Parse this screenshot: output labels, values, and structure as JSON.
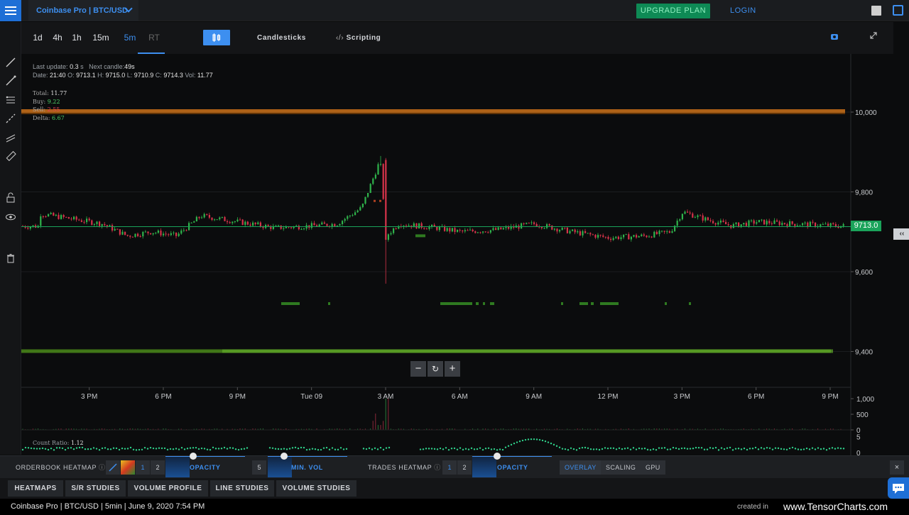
{
  "topbar": {
    "market": "Coinbase Pro | BTC/USD",
    "upgrade": "UPGRADE PLAN",
    "login": "LOGIN"
  },
  "timeframes": [
    "1d",
    "4h",
    "1h",
    "15m",
    "5m",
    "RT"
  ],
  "timeframe_active": "5m",
  "toolbar": {
    "candlesticks": "Candlesticks",
    "scripting": "Scripting"
  },
  "info": {
    "last_update_label": "Last update:",
    "last_update_value": "0.3",
    "last_update_unit": "s",
    "next_candle_label": "Next candle:",
    "next_candle_value": "49s",
    "date_label": "Date:",
    "date": "21:40",
    "o_label": "O:",
    "o": "9713.1",
    "h_label": "H:",
    "h": "9715.0",
    "l_label": "L:",
    "l": "9710.9",
    "c_label": "C:",
    "c": "9714.3",
    "vol_label": "Vol:",
    "vol": "11.77"
  },
  "volume_info": {
    "total_label": "Total:",
    "total": "11.77",
    "buy_label": "Buy:",
    "buy": "9.22",
    "sell_label": "Sell:",
    "sell": "2.55",
    "delta_label": "Delta:",
    "delta": "6.67"
  },
  "current_price": "9713.0",
  "ratio": {
    "label": "Count Ratio:",
    "value": "1.12"
  },
  "colors": {
    "up": "#2fb34b",
    "down": "#d6334a",
    "accent": "#3d8ff0",
    "price_line": "#1aa35a"
  },
  "chart_data": {
    "type": "candlestick",
    "y_axis_ticks": [
      "10,000",
      "9,800",
      "9,600",
      "9,400"
    ],
    "y_range": [
      9350,
      10100
    ],
    "x_ticks": [
      "3 PM",
      "6 PM",
      "9 PM",
      "Tue 09",
      "3 AM",
      "6 AM",
      "9 AM",
      "12 PM",
      "3 PM",
      "6 PM",
      "9 PM"
    ],
    "volume_axis_ticks": [
      "1,000",
      "500",
      "0"
    ],
    "ratio_axis_ticks": [
      "5",
      "0"
    ],
    "orderbook_walls": [
      {
        "price": 10000,
        "side": "ask"
      },
      {
        "price": 9400,
        "side": "bid"
      }
    ],
    "price_path": [
      {
        "t": "13:00",
        "price": 9745
      },
      {
        "t": "14:30",
        "price": 9730
      },
      {
        "t": "15:30",
        "price": 9720
      },
      {
        "t": "16:30",
        "price": 9690
      },
      {
        "t": "17:30",
        "price": 9700
      },
      {
        "t": "18:30",
        "price": 9690
      },
      {
        "t": "19:30",
        "price": 9740
      },
      {
        "t": "21:00",
        "price": 9725
      },
      {
        "t": "22:30",
        "price": 9710
      },
      {
        "t": "00:00",
        "price": 9715
      },
      {
        "t": "01:00",
        "price": 9720
      },
      {
        "t": "02:00",
        "price": 9760
      },
      {
        "t": "02:45",
        "price": 9880
      },
      {
        "t": "03:00",
        "price": 9690
      },
      {
        "t": "03:30",
        "price": 9720
      },
      {
        "t": "05:00",
        "price": 9710
      },
      {
        "t": "06:00",
        "price": 9700
      },
      {
        "t": "07:30",
        "price": 9705
      },
      {
        "t": "09:00",
        "price": 9720
      },
      {
        "t": "10:30",
        "price": 9700
      },
      {
        "t": "12:00",
        "price": 9685
      },
      {
        "t": "13:30",
        "price": 9690
      },
      {
        "t": "14:30",
        "price": 9700
      },
      {
        "t": "15:00",
        "price": 9750
      },
      {
        "t": "16:00",
        "price": 9730
      },
      {
        "t": "17:00",
        "price": 9715
      },
      {
        "t": "18:00",
        "price": 9725
      },
      {
        "t": "19:30",
        "price": 9720
      },
      {
        "t": "21:40",
        "price": 9714
      }
    ]
  },
  "controls": {
    "orderbook_label": "ORDERBOOK HEATMAP",
    "orderbook_num1": "1",
    "orderbook_num2": "2",
    "opacity_1": "OPACITY",
    "opacity_1_level": 0.65,
    "minvol_num": "5",
    "minvol": "MIN. VOL",
    "minvol_level": 0.3,
    "trades_label": "TRADES HEATMAP",
    "trades_num1": "1",
    "trades_num2": "2",
    "opacity_2": "OPACITY",
    "opacity_2_level": 0.55,
    "overlay": "OVERLAY",
    "scaling": "SCALING",
    "gpu": "GPU",
    "close": "×"
  },
  "study_tabs": [
    "HEATMAPS",
    "S/R STUDIES",
    "VOLUME PROFILE",
    "LINE STUDIES",
    "VOLUME STUDIES"
  ],
  "footer": {
    "left": "Coinbase Pro | BTC/USD | 5min | June 9, 2020 7:54 PM",
    "created": "created in",
    "brand": "www.TensorCharts.com"
  }
}
